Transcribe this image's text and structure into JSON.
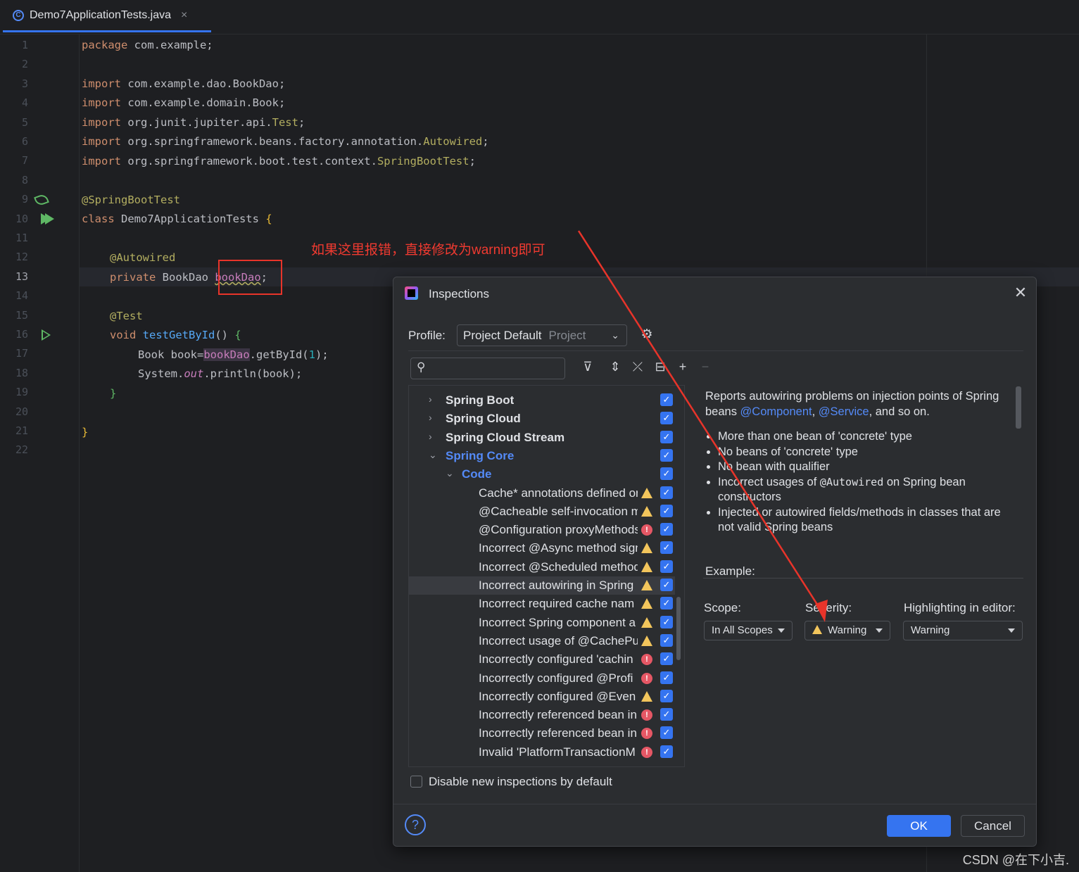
{
  "tab": {
    "filename": "Demo7ApplicationTests.java",
    "close": "×",
    "icon": "C"
  },
  "editor": {
    "line_numbers": [
      "1",
      "2",
      "3",
      "4",
      "5",
      "6",
      "7",
      "8",
      "9",
      "10",
      "11",
      "12",
      "13",
      "14",
      "15",
      "16",
      "17",
      "18",
      "19",
      "20",
      "21",
      "22"
    ],
    "lines": {
      "l1_kw": "package",
      "l1_rest": " com.example;",
      "l3_kw": "import",
      "l3_rest": " com.example.dao.BookDao;",
      "l4_kw": "import",
      "l4_rest": " com.example.domain.Book;",
      "l5_kw": "import",
      "l5_rest": " org.junit.jupiter.api.",
      "l5_cls": "Test",
      "l5_end": ";",
      "l6_kw": "import",
      "l6_rest": " org.springframework.beans.factory.annotation.",
      "l6_cls": "Autowired",
      "l6_end": ";",
      "l7_kw": "import",
      "l7_rest": " org.springframework.boot.test.context.",
      "l7_cls": "SpringBootTest",
      "l7_end": ";",
      "l9_ann": "@SpringBootTest",
      "l10_kw": "class",
      "l10_rest": " Demo7ApplicationTests ",
      "l10_brace": "{",
      "l12_ann": "@Autowired",
      "l13_kw": "private",
      "l13_rest": " BookDao ",
      "l13_fld": "bookDao",
      "l13_end": ";",
      "l15_ann": "@Test",
      "l16_kw": "void",
      "l16_mth": " testGetById",
      "l16_rest": "() ",
      "l16_brace": "{",
      "l17_a": "Book book=",
      "l17_fld": "bookDao",
      "l17_b": ".getById(",
      "l17_num": "1",
      "l17_c": ");",
      "l18_a": "System.",
      "l18_out": "out",
      "l18_b": ".println(book);",
      "l19": "}",
      "l21": "}"
    }
  },
  "annotation_note": "如果这里报错，直接修改为warning即可",
  "dialog": {
    "title": "Inspections",
    "profile_label": "Profile:",
    "profile_value": "Project Default",
    "profile_sub": "Project",
    "tree": [
      {
        "label": "Spring Boot",
        "kind": "group"
      },
      {
        "label": "Spring Cloud",
        "kind": "group"
      },
      {
        "label": "Spring Cloud Stream",
        "kind": "group"
      },
      {
        "label": "Spring Core",
        "kind": "open"
      },
      {
        "label": "Code",
        "kind": "sub"
      },
      {
        "label": "Cache* annotations defined on",
        "kind": "item",
        "sev": "warn"
      },
      {
        "label": "@Cacheable self-invocation m",
        "kind": "item",
        "sev": "warn"
      },
      {
        "label": "@Configuration proxyMethods",
        "kind": "item",
        "sev": "err"
      },
      {
        "label": "Incorrect @Async method sign",
        "kind": "item",
        "sev": "warn"
      },
      {
        "label": "Incorrect @Scheduled method",
        "kind": "item",
        "sev": "warn"
      },
      {
        "label": "Incorrect autowiring in Spring",
        "kind": "item",
        "sev": "warn",
        "selected": true
      },
      {
        "label": "Incorrect required cache nam",
        "kind": "item",
        "sev": "warn"
      },
      {
        "label": "Incorrect Spring component a",
        "kind": "item",
        "sev": "warn"
      },
      {
        "label": "Incorrect usage of @CachePut",
        "kind": "item",
        "sev": "warn"
      },
      {
        "label": "Incorrectly configured 'cachin",
        "kind": "item",
        "sev": "err"
      },
      {
        "label": "Incorrectly configured @Profi",
        "kind": "item",
        "sev": "err"
      },
      {
        "label": "Incorrectly configured  @Even",
        "kind": "item",
        "sev": "warn"
      },
      {
        "label": "Incorrectly referenced bean in",
        "kind": "item",
        "sev": "err"
      },
      {
        "label": "Incorrectly referenced bean in",
        "kind": "item",
        "sev": "err"
      },
      {
        "label": "Invalid 'PlatformTransactionM",
        "kind": "item",
        "sev": "err"
      }
    ],
    "disable_label": "Disable new inspections by default",
    "desc_intro_1": "Reports autowiring problems on injection points of Spring beans ",
    "desc_link1": "@Component",
    "desc_comma": ", ",
    "desc_link2": "@Service",
    "desc_intro_2": ", and so on.",
    "bullets": [
      "More than one bean of 'concrete' type",
      "No beans of 'concrete' type",
      "No bean with qualifier"
    ],
    "bullet4_a": "Incorrect usages of ",
    "bullet4_code": "@Autowired",
    "bullet4_b": " on Spring bean constructors",
    "bullet5": "Injected or autowired fields/methods in classes that are not valid Spring beans",
    "example_label": "Example:",
    "scope_label": "Scope:",
    "scope_value": "In All Scopes",
    "severity_label": "Severity:",
    "severity_value": "Warning",
    "highlight_label": "Highlighting in editor:",
    "highlight_value": "Warning",
    "help": "?",
    "ok": "OK",
    "cancel": "Cancel"
  },
  "watermark": "CSDN @在下小吉.",
  "colors": {
    "accent": "#3574f0",
    "annotation_red": "#e8342a",
    "warning": "#f2c55c",
    "error": "#e55765"
  }
}
